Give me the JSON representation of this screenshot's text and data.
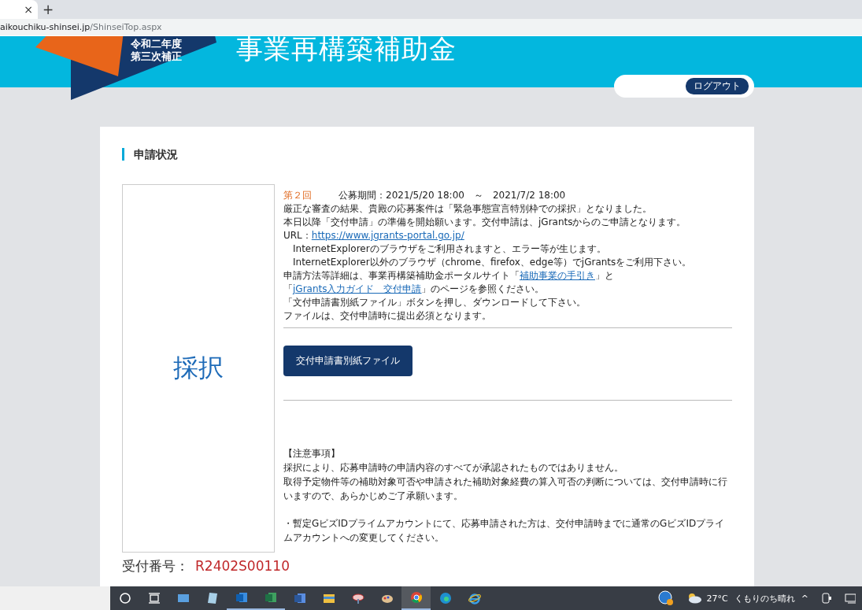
{
  "browser": {
    "tab_close": "×",
    "new_tab": "+",
    "url_host": "aikouchiku-shinsei.jp",
    "url_path": "/ShinseiTop.aspx"
  },
  "banner": {
    "logo_line1": "令和二年度",
    "logo_line2": "第三次補正",
    "title": "事業再構築補助金",
    "logout": "ログアウト"
  },
  "section_title": "申請状況",
  "status_label": "採択",
  "notice": {
    "round": "第２回",
    "period": "公募期間：2021/5/20 18:00　～　2021/7/2 18:00",
    "lines": [
      {
        "indent": false,
        "segments": [
          {
            "kind": "text",
            "text": "厳正な審査の結果、貴殿の応募案件は「緊急事態宣言特別枠での採択」となりました。"
          }
        ]
      },
      {
        "indent": false,
        "segments": [
          {
            "kind": "text",
            "text": "本日以降「交付申請」の準備を開始願います。交付申請は、jGrantsからのご申請となります。"
          }
        ]
      },
      {
        "indent": false,
        "segments": [
          {
            "kind": "text",
            "text": "URL："
          },
          {
            "kind": "link",
            "text": "https://www.jgrants-portal.go.jp/"
          }
        ]
      },
      {
        "indent": true,
        "segments": [
          {
            "kind": "text",
            "text": "InternetExplorerのブラウザをご利用されますと、エラー等が生じます。"
          }
        ]
      },
      {
        "indent": true,
        "segments": [
          {
            "kind": "text",
            "text": "InternetExplorer以外のブラウザ（chrome、firefox、edge等）でjGrantsをご利用下さい。"
          }
        ]
      },
      {
        "indent": false,
        "segments": [
          {
            "kind": "text",
            "text": "申請方法等詳細は、事業再構築補助金ポータルサイト「"
          },
          {
            "kind": "link",
            "text": "補助事業の手引き"
          },
          {
            "kind": "text",
            "text": "」と「"
          },
          {
            "kind": "link",
            "text": "jGrants入力ガイド　交付申請"
          },
          {
            "kind": "text",
            "text": "」のページを参照ください。"
          }
        ]
      },
      {
        "indent": false,
        "segments": [
          {
            "kind": "text",
            "text": "「文付申請書別紙ファイル」ボタンを押し、ダウンロードして下さい。"
          }
        ]
      },
      {
        "indent": false,
        "segments": [
          {
            "kind": "text",
            "text": "ファイルは、交付申請時に提出必須となります。"
          }
        ]
      }
    ],
    "button": "交付申請書別紙ファイル"
  },
  "notes": {
    "heading": "【注意事項】",
    "paragraphs": [
      "採択により、応募申請時の申請内容のすべてが承認されたものではありません。",
      "取得予定物件等の補助対象可否や申請された補助対象経費の算入可否の判断については、交付申請時に行いますので、あらかじめご了承願います。",
      "・暫定GビズIDプライムアカウントにて、応募申請された方は、交付申請時までに通常のGビズIDプライムアカウントへの変更してください。"
    ]
  },
  "receipt": {
    "label": "受付番号：",
    "value": "R2402S00110"
  },
  "taskbar": {
    "apps": [
      {
        "kind": "search-circle",
        "running": false,
        "selected": false
      },
      {
        "kind": "task-view",
        "running": false,
        "selected": false
      },
      {
        "kind": "card",
        "running": false,
        "selected": false
      },
      {
        "kind": "notepad",
        "running": false,
        "selected": false
      },
      {
        "kind": "mail",
        "running": true,
        "selected": false
      },
      {
        "kind": "sheet",
        "running": true,
        "selected": false
      },
      {
        "kind": "doc",
        "running": false,
        "selected": false
      },
      {
        "kind": "folder",
        "running": false,
        "selected": false
      },
      {
        "kind": "satellite",
        "running": false,
        "selected": false
      },
      {
        "kind": "palette",
        "running": false,
        "selected": false
      },
      {
        "kind": "chrome",
        "running": true,
        "selected": true
      },
      {
        "kind": "edge",
        "running": false,
        "selected": false
      },
      {
        "kind": "ie",
        "running": false,
        "selected": false
      }
    ],
    "temperature": "27°C",
    "weather": "くもりのち晴れ",
    "tray_caret": "^"
  }
}
